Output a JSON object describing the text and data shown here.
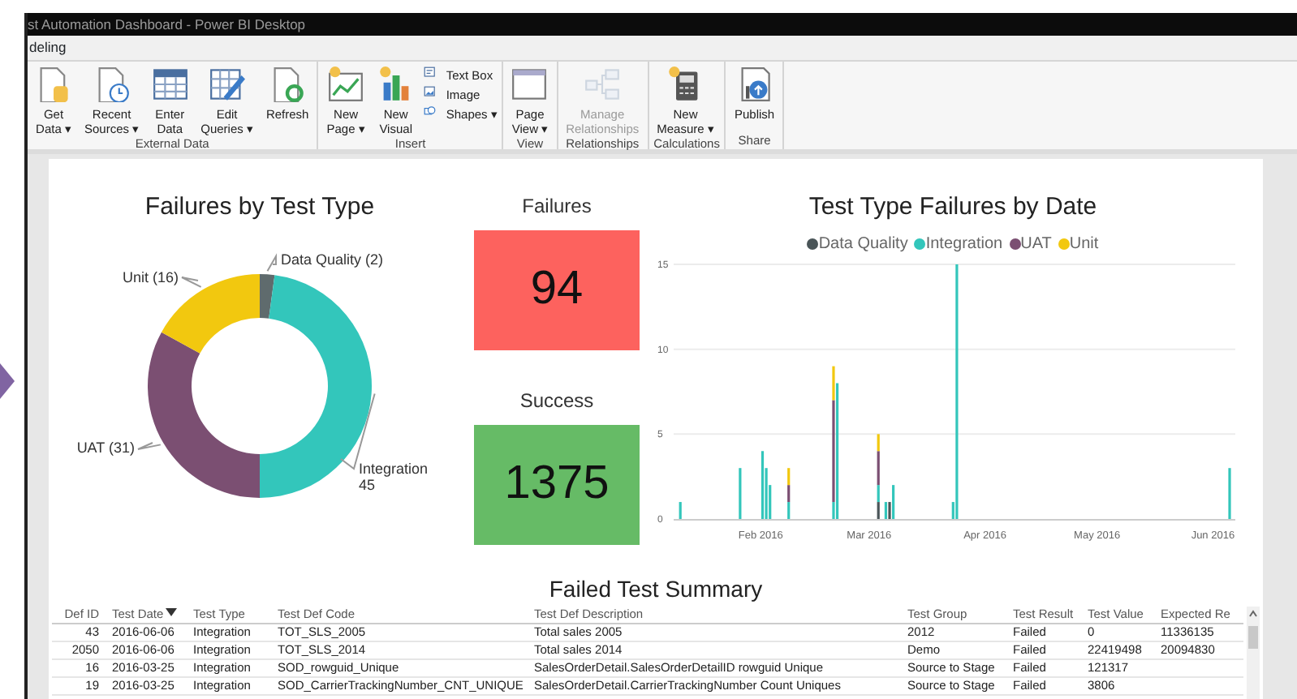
{
  "window": {
    "title": "st Automation Dashboard - Power BI Desktop"
  },
  "menu_tab": {
    "label": "deling"
  },
  "ribbon": {
    "groups": [
      {
        "label": "External Data",
        "items": [
          {
            "kind": "large",
            "lines": [
              "Get",
              "Data ▾"
            ],
            "disabled": false
          },
          {
            "kind": "large",
            "lines": [
              "Recent",
              "Sources ▾"
            ],
            "disabled": false
          },
          {
            "kind": "large",
            "lines": [
              "Enter",
              "Data"
            ],
            "disabled": false
          },
          {
            "kind": "large",
            "lines": [
              "Edit",
              "Queries ▾"
            ],
            "disabled": false
          },
          {
            "kind": "large",
            "lines": [
              "Refresh"
            ],
            "disabled": false
          }
        ]
      },
      {
        "label": "Insert",
        "items": [
          {
            "kind": "large",
            "lines": [
              "New",
              "Page ▾"
            ],
            "disabled": false
          },
          {
            "kind": "large",
            "lines": [
              "New",
              "Visual"
            ],
            "disabled": false
          },
          {
            "kind": "small",
            "lines": [
              "Text Box"
            ],
            "disabled": false
          },
          {
            "kind": "small",
            "lines": [
              "Image"
            ],
            "disabled": false
          },
          {
            "kind": "small",
            "lines": [
              "Shapes ▾"
            ],
            "disabled": false
          }
        ]
      },
      {
        "label": "View",
        "items": [
          {
            "kind": "large",
            "lines": [
              "Page",
              "View ▾"
            ],
            "disabled": false
          }
        ]
      },
      {
        "label": "Relationships",
        "items": [
          {
            "kind": "large",
            "lines": [
              "Manage",
              "Relationships"
            ],
            "disabled": true
          }
        ]
      },
      {
        "label": "Calculations",
        "items": [
          {
            "kind": "large",
            "lines": [
              "New",
              "Measure ▾"
            ],
            "disabled": false
          }
        ]
      },
      {
        "label": "Share",
        "items": [
          {
            "kind": "large",
            "lines": [
              "Publish"
            ],
            "disabled": false
          }
        ]
      }
    ]
  },
  "donut": {
    "chart_data": {
      "type": "donut",
      "title": "Failures by Test Type",
      "categories": [
        "Data Quality",
        "Integration",
        "UAT",
        "Unit"
      ],
      "values": [
        2,
        45,
        31,
        16
      ],
      "colors": [
        "#5f6b6d",
        "#33c6bb",
        "#7b4f72",
        "#f2c80f"
      ],
      "value_labels": [
        "(2)",
        "45",
        "(31)",
        "(16)"
      ]
    }
  },
  "cards": [
    {
      "title": "Failures",
      "value": "94",
      "color": "#fd625e"
    },
    {
      "title": "Success",
      "value": "1375",
      "color": "#66bb66"
    }
  ],
  "timeline": {
    "chart_data": {
      "type": "bar",
      "stacked": true,
      "title": "Test Type Failures by Date",
      "x": [
        "2016-01-11",
        "2016-01-27",
        "2016-02-02",
        "2016-02-03",
        "2016-02-04",
        "2016-02-09",
        "2016-02-21",
        "2016-02-22",
        "2016-03-04",
        "2016-03-06",
        "2016-03-07",
        "2016-03-08",
        "2016-03-24",
        "2016-03-25",
        "2016-06-06"
      ],
      "series": [
        {
          "name": "Data Quality",
          "color": "#4a5558",
          "values": [
            0,
            0,
            0,
            0,
            0,
            0,
            0,
            0,
            1,
            0,
            1,
            0,
            0,
            0,
            0
          ]
        },
        {
          "name": "Integration",
          "color": "#33c6bb",
          "values": [
            1,
            3,
            4,
            3,
            2,
            1,
            1,
            8,
            1,
            1,
            0,
            2,
            1,
            15,
            3
          ]
        },
        {
          "name": "UAT",
          "color": "#7b4f72",
          "values": [
            0,
            0,
            0,
            0,
            0,
            1,
            6,
            0,
            2,
            0,
            0,
            0,
            0,
            0,
            0
          ]
        },
        {
          "name": "Unit",
          "color": "#f2c80f",
          "values": [
            0,
            0,
            0,
            0,
            0,
            1,
            2,
            0,
            1,
            0,
            0,
            0,
            0,
            0,
            0
          ]
        }
      ],
      "xlim": [
        "2016-01-10",
        "2016-06-07"
      ],
      "ylim": [
        0,
        15
      ],
      "yticks": [
        0,
        5,
        10,
        15
      ],
      "xticks": [
        {
          "value": "2016-02-01",
          "label": "Feb 2016"
        },
        {
          "value": "2016-03-01",
          "label": "Mar 2016"
        },
        {
          "value": "2016-04-01",
          "label": "Apr 2016"
        },
        {
          "value": "2016-05-01",
          "label": "May 2016"
        },
        {
          "value": "2016-06-01",
          "label": "Jun 2016"
        }
      ]
    }
  },
  "table": {
    "title": "Failed Test Summary",
    "columns": [
      {
        "label": "Def ID",
        "sorted_descending": false
      },
      {
        "label": "Test Date",
        "sorted_descending": true
      },
      {
        "label": "Test Type",
        "sorted_descending": false
      },
      {
        "label": "Test Def Code",
        "sorted_descending": false
      },
      {
        "label": "Test Def Description",
        "sorted_descending": false
      },
      {
        "label": "Test Group",
        "sorted_descending": false
      },
      {
        "label": "Test Result",
        "sorted_descending": false
      },
      {
        "label": "Test Value",
        "sorted_descending": false
      },
      {
        "label": "Expected Re",
        "sorted_descending": false
      }
    ],
    "rows": [
      [
        "43",
        "2016-06-06",
        "Integration",
        "TOT_SLS_2005",
        "Total sales 2005",
        "2012",
        "Failed",
        "0",
        "11336135"
      ],
      [
        "2050",
        "2016-06-06",
        "Integration",
        "TOT_SLS_2014",
        "Total sales 2014",
        "Demo",
        "Failed",
        "22419498",
        "20094830"
      ],
      [
        "16",
        "2016-03-25",
        "Integration",
        "SOD_rowguid_Unique",
        "SalesOrderDetail.SalesOrderDetailID rowguid Unique",
        "Source to Stage",
        "Failed",
        "121317",
        ""
      ],
      [
        "19",
        "2016-03-25",
        "Integration",
        "SOD_CarrierTrackingNumber_CNT_UNIQUE",
        "SalesOrderDetail.CarrierTrackingNumber Count Uniques",
        "Source to Stage",
        "Failed",
        "3806",
        ""
      ]
    ]
  }
}
